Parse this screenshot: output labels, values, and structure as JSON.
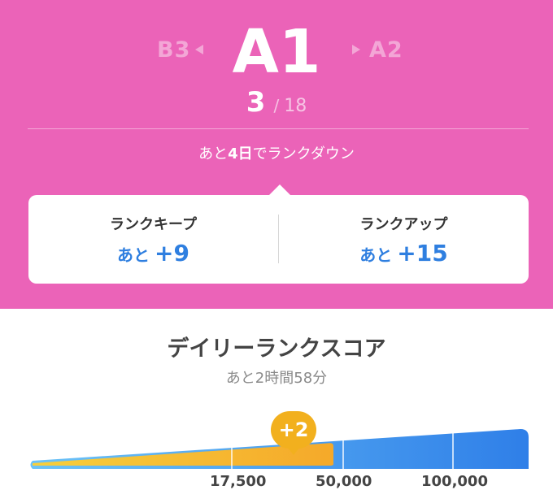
{
  "rank": {
    "previous": "B3",
    "current": "A1",
    "next": "A2",
    "position": "3",
    "separator": "/",
    "total": "18"
  },
  "countdown": {
    "prefix": "あと",
    "days": "4日",
    "suffix": "でランクダウン"
  },
  "targets": {
    "keep": {
      "label": "ランクキープ",
      "prefix": "あと",
      "value": "+9"
    },
    "up": {
      "label": "ランクアップ",
      "prefix": "あと",
      "value": "+15"
    }
  },
  "daily": {
    "title": "デイリーランクスコア",
    "time_left": "あと2時間58分",
    "gain_badge": "+2",
    "progress_fraction": 0.61,
    "tick_labels": [
      "17,500",
      "50,000",
      "100,000"
    ]
  },
  "colors": {
    "hero_bg": "#eb63b8",
    "accent_blue": "#2f7fe0",
    "gauge_fill": "#f2b01e",
    "gauge_blue": "#3f8ef0"
  }
}
